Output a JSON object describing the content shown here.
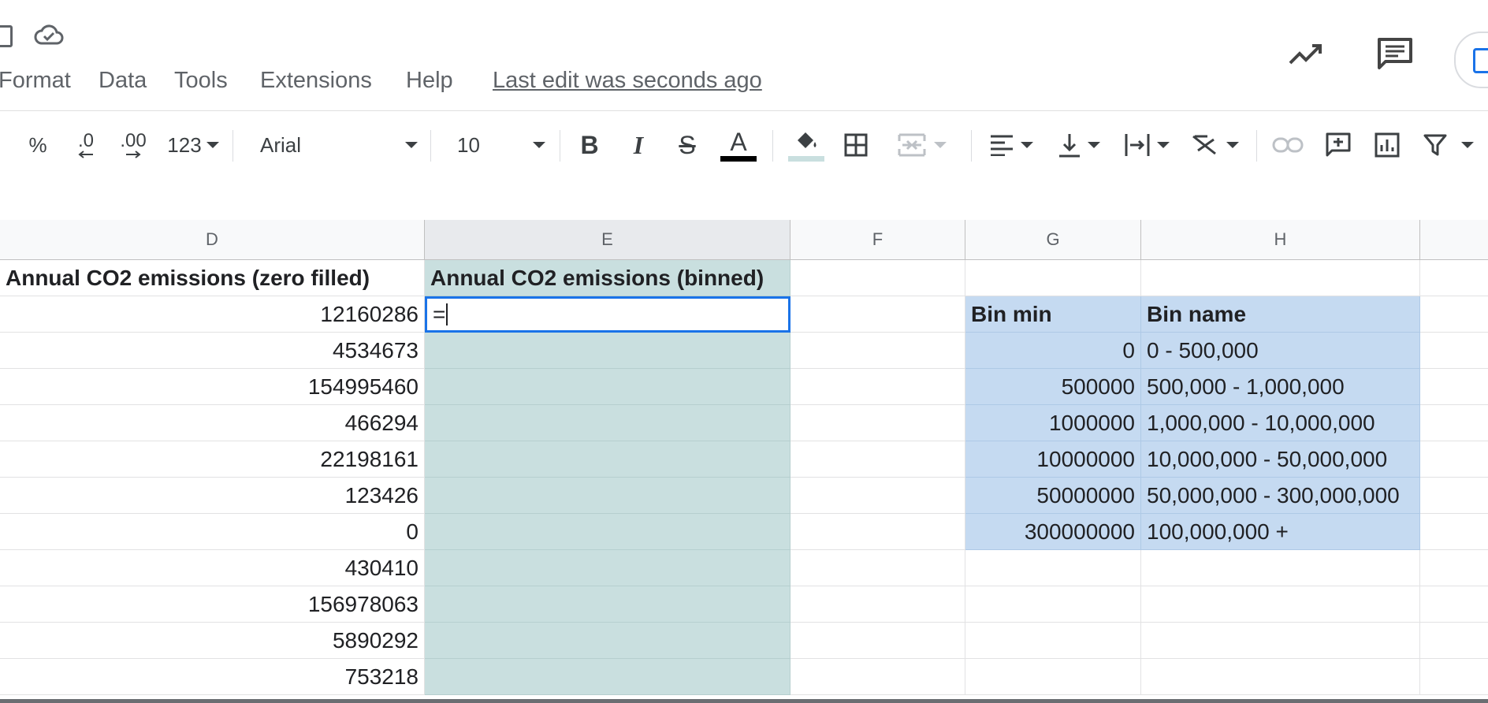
{
  "menu": {
    "items": [
      "Format",
      "Data",
      "Tools",
      "Extensions",
      "Help"
    ],
    "last_edit": "Last edit was seconds ago"
  },
  "toolbar": {
    "percent": "%",
    "decrease_decimal": ".0",
    "increase_decimal": ".00",
    "more_formats": "123",
    "font": "Arial",
    "font_size": "10",
    "text_color": "#000000",
    "fill_color": "#c9dfdf"
  },
  "grid": {
    "columns": [
      "D",
      "E",
      "F",
      "G",
      "H"
    ],
    "headers": {
      "d": "Annual CO2 emissions (zero filled)",
      "e": "Annual CO2 emissions (binned)"
    },
    "active_cell_value": "=",
    "d_values": [
      "12160286",
      "4534673",
      "154995460",
      "466294",
      "22198161",
      "123426",
      "0",
      "430410",
      "156978063",
      "5890292",
      "753218"
    ],
    "bin_table": {
      "header_min": "Bin min",
      "header_name": "Bin name",
      "rows": [
        {
          "min": "0",
          "name": "0 - 500,000"
        },
        {
          "min": "500000",
          "name": "500,000 - 1,000,000"
        },
        {
          "min": "1000000",
          "name": "1,000,000 - 10,000,000"
        },
        {
          "min": "10000000",
          "name": "10,000,000 - 50,000,000"
        },
        {
          "min": "50000000",
          "name": "50,000,000 - 300,000,000"
        },
        {
          "min": "300000000",
          "name": "100,000,000 +"
        }
      ]
    }
  },
  "colors": {
    "teal_fill": "#c9dfdf",
    "blue_fill": "#c5daf1",
    "selection_border": "#1a73e8"
  }
}
